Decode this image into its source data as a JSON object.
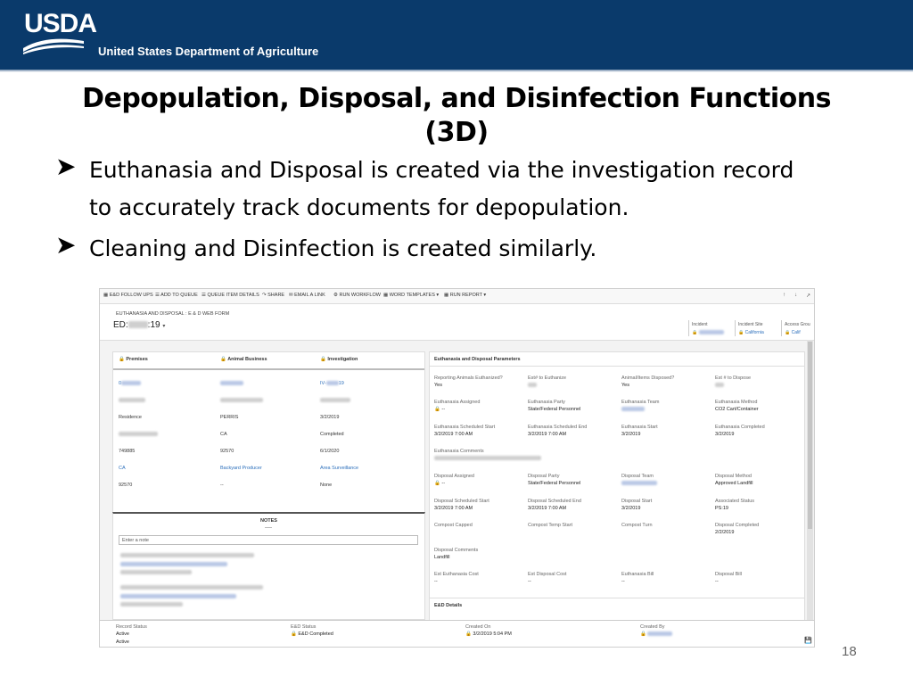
{
  "header": {
    "logo_text": "USDA",
    "department": "United States Department of Agriculture"
  },
  "slide": {
    "title_line1": "Depopulation, Disposal, and Disinfection Functions",
    "title_line2": "(3D)",
    "bullets": [
      {
        "line1": "Euthanasia and Disposal is created via the investigation record",
        "line2": "to accurately track documents for depopulation."
      },
      {
        "line1": "Cleaning and Disinfection is created similarly."
      }
    ],
    "page_number": "18"
  },
  "toolbar": {
    "items": [
      "E&D FOLLOW UPS",
      "ADD TO QUEUE",
      "QUEUE ITEM DETAILS",
      "SHARE",
      "EMAIL A LINK",
      "RUN WORKFLOW",
      "WORD TEMPLATES",
      "RUN REPORT"
    ]
  },
  "form": {
    "type_label": "EUTHANASIA AND DISPOSAL : E & D WEB FORM",
    "id_prefix": "ED:",
    "id_suffix": ":19",
    "header_fields": [
      {
        "label": "Incident",
        "value": ""
      },
      {
        "label": "Incident Site",
        "value": "California"
      },
      {
        "label": "Access Grou",
        "value": "Calif"
      }
    ]
  },
  "premises_table": {
    "headers": [
      "Premises",
      "Animal Business",
      "Investigation"
    ],
    "rows": [
      [
        "0",
        "",
        "IV-19"
      ],
      [
        "",
        "",
        ""
      ],
      [
        "Residence",
        "PERRIS",
        "3/2/2019"
      ],
      [
        "",
        "CA",
        "Completed"
      ],
      [
        "749885",
        "92570",
        "6/1/2020"
      ],
      [
        "CA",
        "Backyard Producer",
        "Area Surveillance"
      ],
      [
        "92570",
        "--",
        "None"
      ]
    ]
  },
  "notes": {
    "title": "NOTES",
    "placeholder": "Enter a note"
  },
  "parameters": {
    "title": "Euthanasia and Disposal Parameters",
    "rows": [
      [
        {
          "label": "Reporting Animals Euthanized?",
          "value": "Yes"
        },
        {
          "label": "Est# to Euthanize",
          "value": ""
        },
        {
          "label": "Animal/Items Disposed?",
          "value": "Yes"
        },
        {
          "label": "Est # to Dispose",
          "value": ""
        }
      ],
      [
        {
          "label": "Euthanasia Assigned",
          "value": "--"
        },
        {
          "label": "Euthanasia Party",
          "value": "State/Federal Personnel"
        },
        {
          "label": "Euthanasia Team",
          "value": ""
        },
        {
          "label": "Euthanasia Method",
          "value": "CO2 Cart/Container"
        }
      ],
      [
        {
          "label": "Euthanasia Scheduled Start",
          "value": "3/2/2019   7:00 AM"
        },
        {
          "label": "Euthanasia Scheduled End",
          "value": "3/2/2019   7:00 AM"
        },
        {
          "label": "Euthanasia Start",
          "value": "3/2/2019"
        },
        {
          "label": "Euthanasia Completed",
          "value": "3/2/2019"
        }
      ],
      [
        {
          "label": "Euthanasia Comments",
          "value": ""
        }
      ],
      [
        {
          "label": "Disposal Assigned",
          "value": "--"
        },
        {
          "label": "Disposal Party",
          "value": "State/Federal Personnel"
        },
        {
          "label": "Disposal Team",
          "value": ""
        },
        {
          "label": "Disposal Method",
          "value": "Approved Landfill"
        }
      ],
      [
        {
          "label": "Disposal Scheduled Start",
          "value": "3/2/2019   7:00 AM"
        },
        {
          "label": "Disposal Scheduled End",
          "value": "3/2/2019   7:00 AM"
        },
        {
          "label": "Disposal Start",
          "value": "3/2/2019"
        },
        {
          "label": "Associated Status",
          "value": "PS:19"
        }
      ],
      [
        {
          "label": "Compost Capped",
          "value": ""
        },
        {
          "label": "Compost Temp Start",
          "value": ""
        },
        {
          "label": "Compost Turn",
          "value": ""
        },
        {
          "label": "Disposal Completed",
          "value": "2/2/2019"
        }
      ],
      [
        {
          "label": "Disposal Comments",
          "value": "Landfill"
        }
      ],
      [
        {
          "label": "Est Euthanasia Cost",
          "value": "--"
        },
        {
          "label": "Est Disposal Cost",
          "value": "--"
        },
        {
          "label": "Euthanasia Bill",
          "value": "--"
        },
        {
          "label": "Disposal Bill",
          "value": "--"
        }
      ]
    ],
    "details_title": "E&D Details"
  },
  "footer": {
    "fields": [
      {
        "label": "Record Status",
        "value": "Active",
        "extra": "Active"
      },
      {
        "label": "E&D Status",
        "value": "E&D Completed"
      },
      {
        "label": "Created On",
        "value": "3/2/2019   5:04 PM"
      },
      {
        "label": "Created By",
        "value": ""
      }
    ]
  }
}
